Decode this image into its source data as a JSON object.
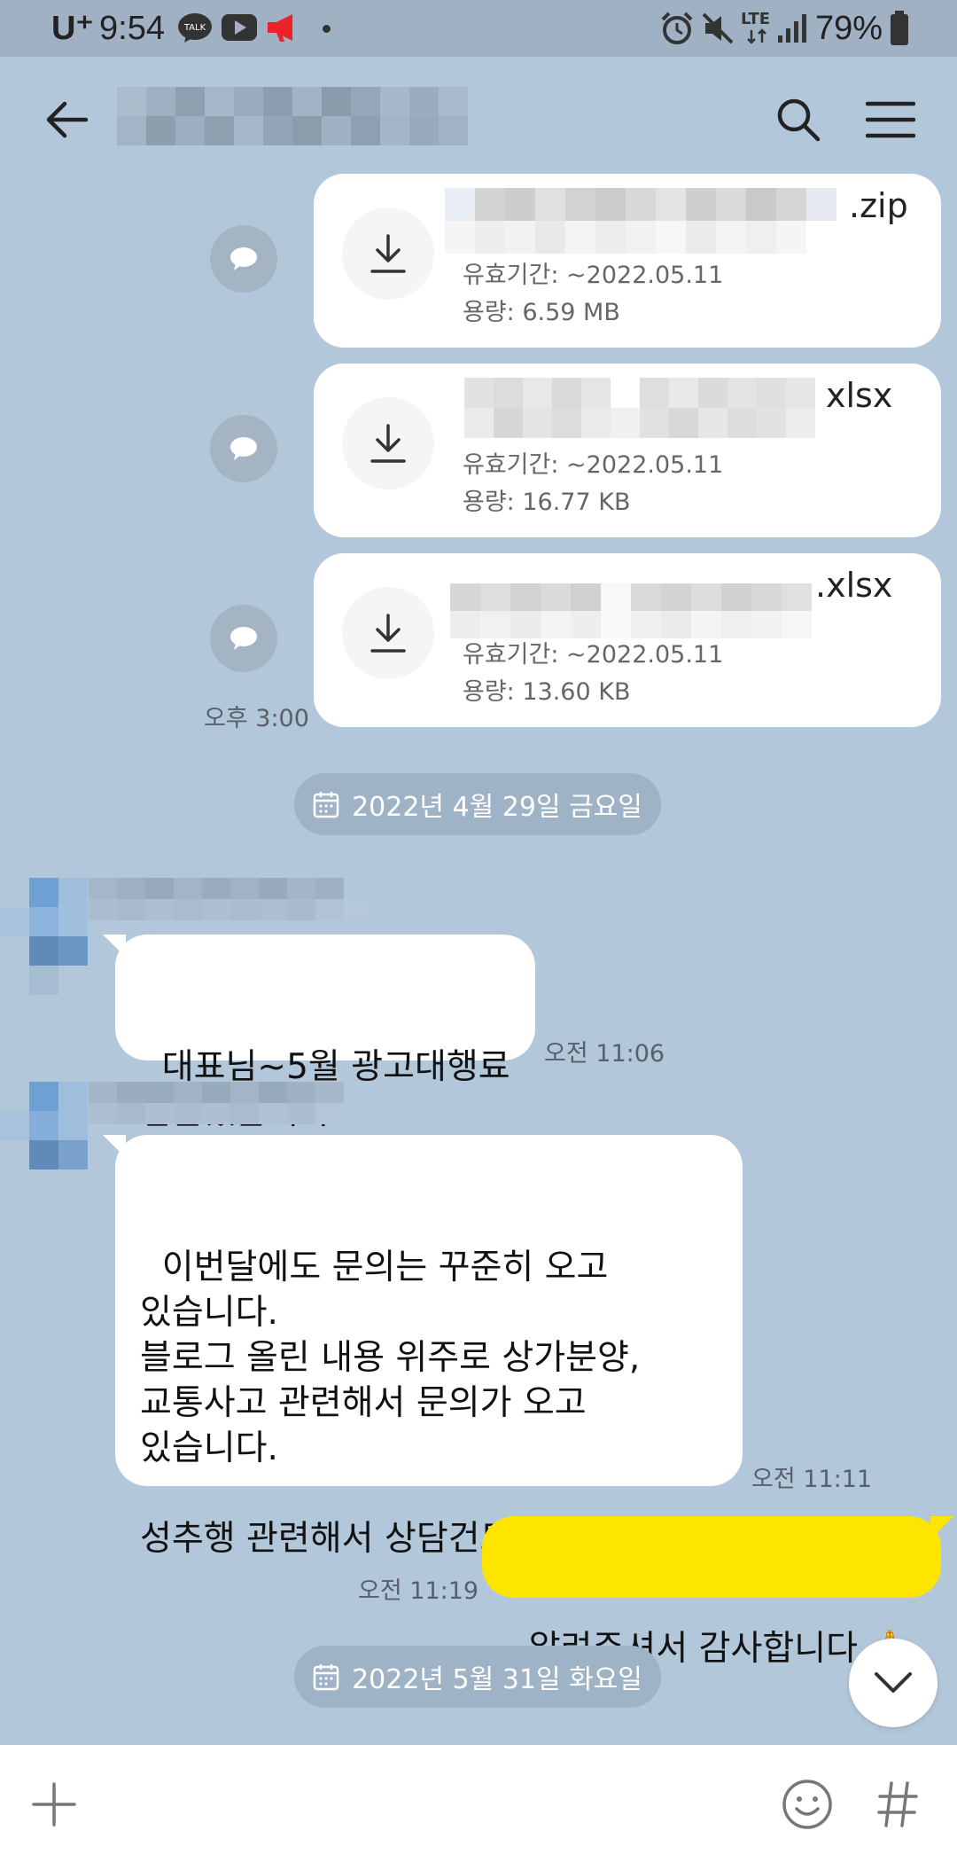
{
  "status_bar": {
    "carrier": "U⁺",
    "time": "9:54",
    "battery": "79%",
    "network": "LTE"
  },
  "header": {
    "back_icon": "arrow-left-icon",
    "search_icon": "search-icon",
    "menu_icon": "hamburger-menu-icon"
  },
  "files": [
    {
      "name_suffix": ".zip",
      "expiry": "유효기간: ~2022.05.11",
      "size": "용량: 6.59 MB"
    },
    {
      "name_suffix": "xlsx",
      "expiry": "유효기간: ~2022.05.11",
      "size": "용량: 16.77 KB"
    },
    {
      "name_suffix": ".xlsx",
      "expiry": "유효기간: ~2022.05.11",
      "size": "용량: 13.60 KB"
    }
  ],
  "files_time": "오후 3:00",
  "dates": [
    "2022년 4월 29일 금요일",
    "2022년 5월 31일 화요일"
  ],
  "messages": [
    {
      "text": "대표님~5월 광고대행료\n입금했습니다.",
      "time": "오전 11:06"
    },
    {
      "text": "이번달에도 문의는 꾸준히 오고\n있습니다.\n블로그 올린 내용 위주로 상가분양,\n교통사고 관련해서 문의가 오고\n있습니다.\n\n성추행 관련해서 상담건도 있었습니다.",
      "time": "오전 11:11"
    },
    {
      "text": "알려주셔서 감사합니다 🙏",
      "time": "오전 11:19"
    }
  ],
  "input_bar": {
    "plus_icon": "plus-icon",
    "emoji_icon": "smiley-icon",
    "hash_icon": "hash-icon"
  },
  "colors": {
    "background": "#b2c7da",
    "my_bubble": "#fee500",
    "their_bubble": "#ffffff",
    "status_bar": "#9fb1c3"
  }
}
